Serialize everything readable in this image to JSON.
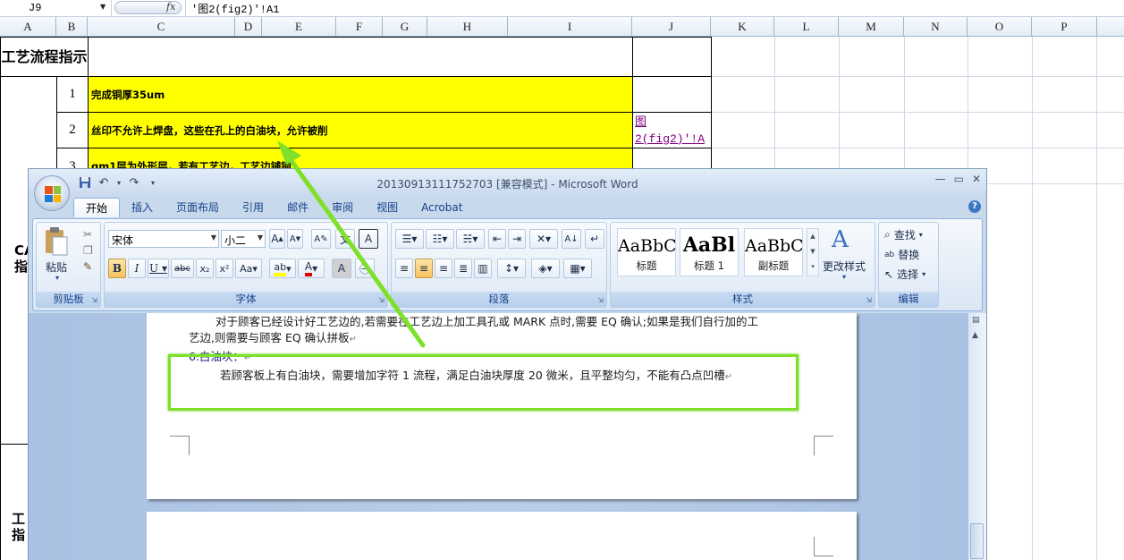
{
  "excel": {
    "name_box": "J9",
    "fx": "fx",
    "formula": "'图2(fig2)'!A1",
    "columns": [
      "A",
      "B",
      "C",
      "D",
      "E",
      "F",
      "G",
      "H",
      "I",
      "J",
      "K",
      "L",
      "M",
      "N",
      "O",
      "P"
    ],
    "row_header": "工艺流程指示",
    "rows": [
      {
        "num": "1",
        "text": "完成铜厚35um"
      },
      {
        "num": "2",
        "text": "丝印不允许上焊盘，这些在孔上的白油块，允许被削"
      },
      {
        "num": "3",
        "text": "gm1层为外形层，若有工艺边，工艺边铺铜"
      }
    ],
    "link_text": "图\n2(fig2)'!A",
    "left_text_1": "CA\n指",
    "left_text_2": "工\n指"
  },
  "word": {
    "title": "20130913111752703 [兼容模式] - Microsoft Word",
    "tabs": [
      "开始",
      "插入",
      "页面布局",
      "引用",
      "邮件",
      "审阅",
      "视图",
      "Acrobat"
    ],
    "active_tab": "开始",
    "clipboard": {
      "paste": "粘贴",
      "label": "剪贴板"
    },
    "font": {
      "name": "宋体",
      "size": "小二",
      "label": "字体"
    },
    "paragraph_label": "段落",
    "styles": {
      "label": "样式",
      "items": [
        {
          "sample": "AaBbC",
          "name": "标题"
        },
        {
          "sample": "AaBl",
          "name": "标题 1"
        },
        {
          "sample": "AaBbC",
          "name": "副标题"
        }
      ],
      "change": "更改样式"
    },
    "editing": {
      "find": "查找",
      "replace": "替换",
      "select": "选择",
      "label": "编辑"
    },
    "doc": {
      "line1": "对于顾客已经设计好工艺边的,若需要在工艺边上加工具孔或 MARK 点时,需要 EQ 确认;如果是我们自行加的工",
      "line2": "艺边,则需要与顾客 EQ 确认拼板",
      "heading": "6.白油块：",
      "body": "若顾客板上有白油块，需要增加字符 1 流程，满足白油块厚度 20 微米，且平整均匀，不能有凸点凹槽"
    }
  },
  "colors": {
    "highlight": "#ffff00",
    "annotation": "#7ee02a",
    "link": "#800080"
  }
}
